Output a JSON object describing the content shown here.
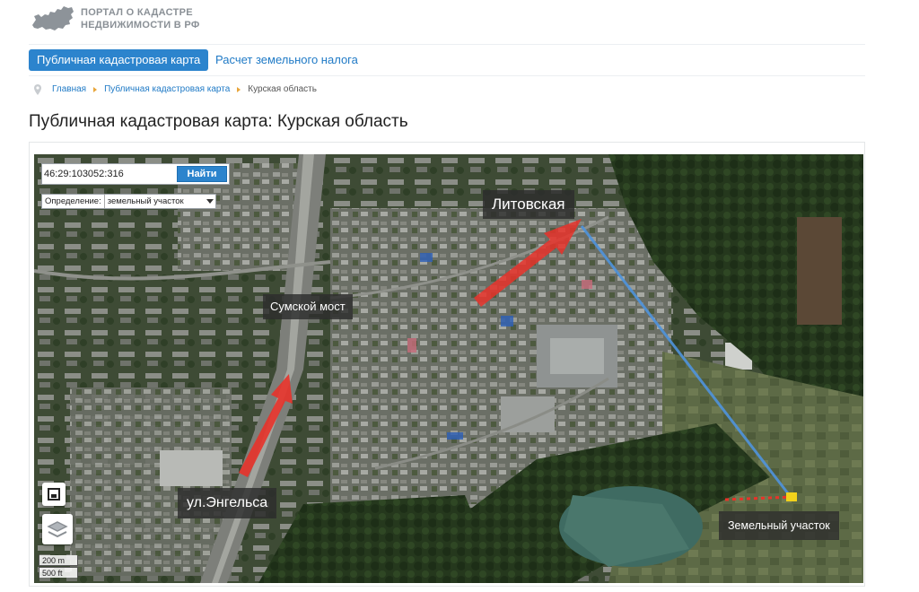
{
  "header": {
    "logo_icon": "russia-map-icon",
    "logo_line1": "ПОРТАЛ О КАДАСТРЕ",
    "logo_line2": "НЕДВИЖИМОСТИ В РФ"
  },
  "nav": {
    "tabs": [
      {
        "label": "Публичная кадастровая карта",
        "active": true
      },
      {
        "label": "Расчет земельного налога",
        "active": false
      }
    ]
  },
  "breadcrumb": {
    "icon": "location-pin-icon",
    "items": [
      "Главная",
      "Публичная кадастровая карта",
      "Курская область"
    ]
  },
  "page": {
    "title": "Публичная кадастровая карта: Курская область"
  },
  "map": {
    "search": {
      "value": "46:29:103052:316",
      "button_label": "Найти"
    },
    "definition": {
      "label": "Определение:",
      "selected": "земельный участок"
    },
    "labels": {
      "litovskaya": "Литовская",
      "sumskoy_most": "Сумской мост",
      "engelsa": "ул.Энгельса",
      "zemelny_uchastok": "Земельный участок"
    },
    "scale": {
      "metric": "200 m",
      "imperial": "500 ft"
    },
    "controls": {
      "fullscreen_icon": "fullscreen-icon",
      "layers_icon": "layers-icon"
    },
    "colors": {
      "arrow": "#e8332a",
      "route_line": "#4f93dd",
      "parcel": "#f2d21b"
    }
  }
}
